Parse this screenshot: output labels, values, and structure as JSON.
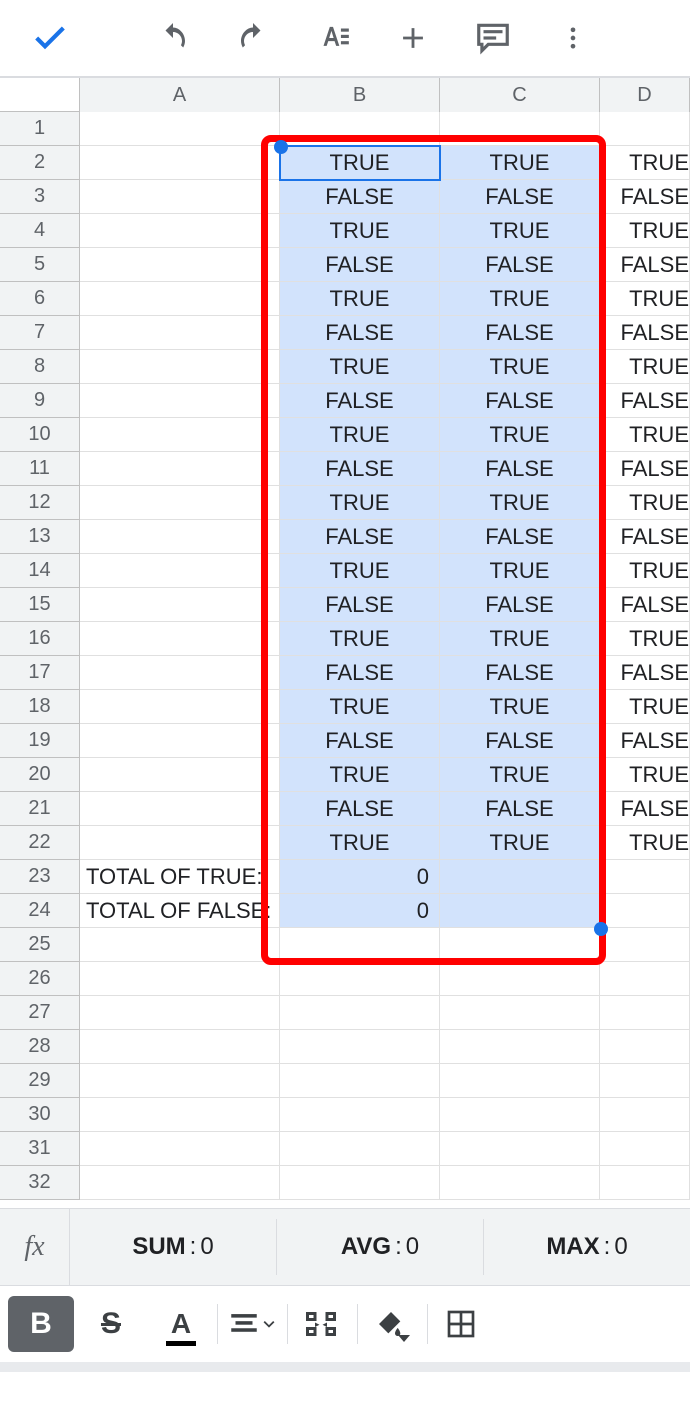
{
  "toolbar": {
    "accept": "✓",
    "undo": "↶",
    "redo": "↷",
    "format": "A≡",
    "insert": "+",
    "comment": "💬",
    "more": "⋮"
  },
  "columns": [
    "A",
    "B",
    "C",
    "D"
  ],
  "row_numbers": [
    1,
    2,
    3,
    4,
    5,
    6,
    7,
    8,
    9,
    10,
    11,
    12,
    13,
    14,
    15,
    16,
    17,
    18,
    19,
    20,
    21,
    22,
    23,
    24,
    25,
    26,
    27,
    28,
    29,
    30,
    31,
    32
  ],
  "grid": {
    "A": {
      "23": "TOTAL OF TRUE:",
      "24": "TOTAL OF FALSE:"
    },
    "B": {
      "2": "TRUE",
      "3": "FALSE",
      "4": "TRUE",
      "5": "FALSE",
      "6": "TRUE",
      "7": "FALSE",
      "8": "TRUE",
      "9": "FALSE",
      "10": "TRUE",
      "11": "FALSE",
      "12": "TRUE",
      "13": "FALSE",
      "14": "TRUE",
      "15": "FALSE",
      "16": "TRUE",
      "17": "FALSE",
      "18": "TRUE",
      "19": "FALSE",
      "20": "TRUE",
      "21": "FALSE",
      "22": "TRUE",
      "23": "0",
      "24": "0"
    },
    "C": {
      "2": "TRUE",
      "3": "FALSE",
      "4": "TRUE",
      "5": "FALSE",
      "6": "TRUE",
      "7": "FALSE",
      "8": "TRUE",
      "9": "FALSE",
      "10": "TRUE",
      "11": "FALSE",
      "12": "TRUE",
      "13": "FALSE",
      "14": "TRUE",
      "15": "FALSE",
      "16": "TRUE",
      "17": "FALSE",
      "18": "TRUE",
      "19": "FALSE",
      "20": "TRUE",
      "21": "FALSE",
      "22": "TRUE"
    },
    "D": {
      "2": "TRUE",
      "3": "FALSE",
      "4": "TRUE",
      "5": "FALSE",
      "6": "TRUE",
      "7": "FALSE",
      "8": "TRUE",
      "9": "FALSE",
      "10": "TRUE",
      "11": "FALSE",
      "12": "TRUE",
      "13": "FALSE",
      "14": "TRUE",
      "15": "FALSE",
      "16": "TRUE",
      "17": "FALSE",
      "18": "TRUE",
      "19": "FALSE",
      "20": "TRUE",
      "21": "FALSE",
      "22": "TRUE"
    }
  },
  "selection": {
    "active_cell": "B2",
    "range": "B2:C24"
  },
  "stats": {
    "sum_label": "SUM",
    "sum_value": "0",
    "avg_label": "AVG",
    "avg_value": "0",
    "max_label": "MAX",
    "max_value": "0"
  },
  "formatbar": {
    "bold": "B",
    "strike": "S",
    "textcolor": "A",
    "align": "≡",
    "merge": "⇥⇤",
    "fill": "◆",
    "borders": "▦"
  }
}
